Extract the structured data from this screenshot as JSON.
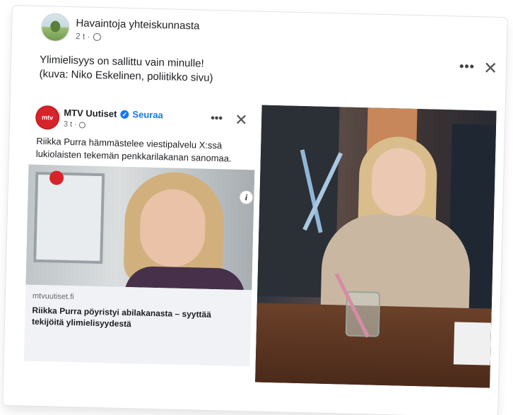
{
  "post": {
    "page_name": "Havaintoja yhteiskunnasta",
    "time": "2 t ·",
    "text_line1": "Ylimielisyys on sallittu vain minulle!",
    "text_line2": "(kuva: Niko Eskelinen, poliitikko sivu)",
    "more_icon": "more-horizontal-icon",
    "close_icon": "close-icon"
  },
  "shared": {
    "name": "MTV Uutiset",
    "verified_icon": "verified-badge-icon",
    "follow": "Seuraa",
    "time": "3 t ·",
    "text": "Riikka Purra hämmästelee viestipalvelu X:ssä lukiolaisten tekemän penkkarilakanan sanomaa.",
    "logo_text": "mtv",
    "info_icon": "i",
    "link_domain": "mtvuutiset.fi",
    "link_title": "Riikka Purra pöyristyi abilakanasta – syyttää tekijöitä ylimielisyydestä"
  },
  "colors": {
    "link_blue": "#1877f2",
    "mtv_red": "#d8232a",
    "text_primary": "#1c1e21",
    "text_secondary": "#65676b"
  }
}
